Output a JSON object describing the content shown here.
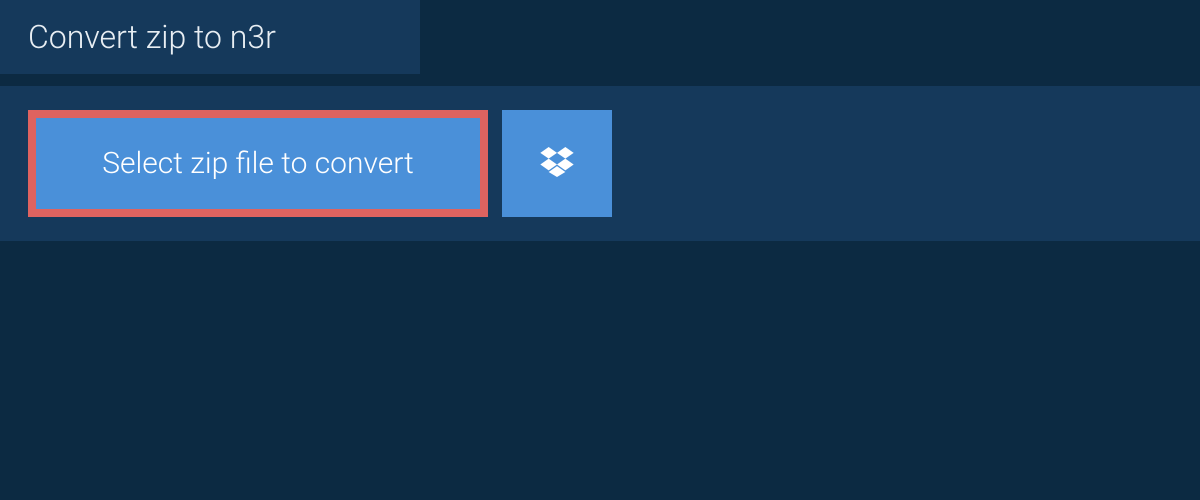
{
  "header": {
    "title": "Convert zip to n3r"
  },
  "upload": {
    "select_button_label": "Select zip file to convert",
    "dropbox_icon": "dropbox-icon"
  },
  "colors": {
    "page_bg": "#0c2a42",
    "panel_bg": "#15395b",
    "button_bg": "#4a90d9",
    "highlight_border": "#de6360",
    "text_light": "#e8eef3",
    "text_white": "#ffffff"
  }
}
